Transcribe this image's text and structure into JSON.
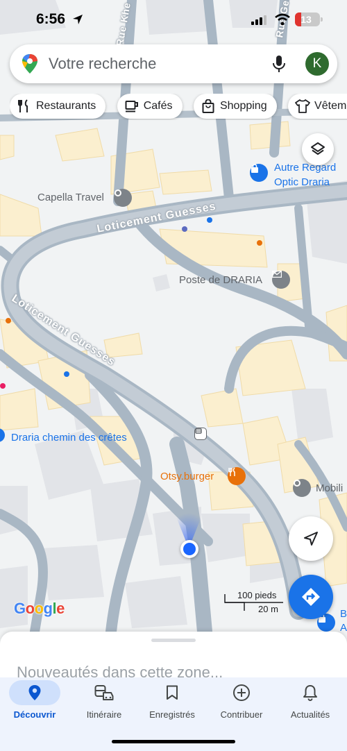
{
  "status_bar": {
    "time": "6:56",
    "battery": "13"
  },
  "search": {
    "placeholder": "Votre recherche",
    "avatar_letter": "K"
  },
  "chips": [
    {
      "label": "Restaurants",
      "icon": "fork-knife-icon"
    },
    {
      "label": "Cafés",
      "icon": "coffee-cup-icon"
    },
    {
      "label": "Shopping",
      "icon": "shopping-bag-icon"
    },
    {
      "label": "Vêteme",
      "icon": "tshirt-icon"
    }
  ],
  "map": {
    "roads": {
      "upper": "Loticement Guesses",
      "lower": "Loticement Guesses",
      "vertical_1": "Rue Khe",
      "vertical_2": "Rue Ges"
    },
    "places": {
      "capella": "Capella Travel",
      "autre_regard_1": "Autre Regard",
      "autre_regard_2": "Optic Draria",
      "poste": "Poste de DRARIA",
      "draria_chemin": "Draria chemin des crêtes",
      "otsy": "Otsy.burger",
      "mobili": "Mobili",
      "b_a_1": "B",
      "b_a_2": "A"
    },
    "scale": {
      "imperial": "100 pieds",
      "metric": "20 m"
    },
    "attribution": "Google",
    "colors": {
      "road": "#a9b7c4",
      "building_yellow": "#fdf1d2",
      "building_gray": "#dfe1e5",
      "accent_blue": "#1a73e8",
      "accent_orange": "#e8710a"
    }
  },
  "sheet": {
    "headline": "Nouveautés dans cette zone..."
  },
  "nav": {
    "items": [
      {
        "label": "Découvrir",
        "icon": "explore-pin-icon",
        "active": true
      },
      {
        "label": "Itinéraire",
        "icon": "commute-icon",
        "active": false
      },
      {
        "label": "Enregistrés",
        "icon": "bookmark-icon",
        "active": false
      },
      {
        "label": "Contribuer",
        "icon": "add-circle-icon",
        "active": false
      },
      {
        "label": "Actualités",
        "icon": "bell-icon",
        "active": false
      }
    ]
  }
}
